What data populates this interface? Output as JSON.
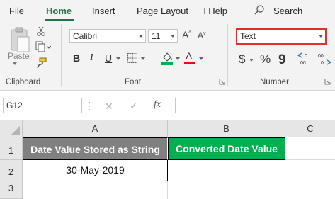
{
  "menu": {
    "tabs": [
      "File",
      "Home",
      "Insert",
      "Page Layout",
      "Help"
    ],
    "search_label": "Search"
  },
  "ribbon": {
    "clipboard": {
      "paste_label": "Paste",
      "group_label": "Clipboard"
    },
    "font": {
      "font_name": "Calibri",
      "font_size": "11",
      "group_label": "Font"
    },
    "number": {
      "format_value": "Text",
      "group_label": "Number"
    }
  },
  "formula_bar": {
    "name_box": "G12",
    "fx_label": "fx",
    "formula": ""
  },
  "grid": {
    "columns": [
      "A",
      "B",
      "C"
    ],
    "rows": [
      "1",
      "2",
      "3"
    ],
    "cells": {
      "A1": "Date Value Stored as String",
      "B1": "Converted Date Value",
      "A2": "30-May-2019",
      "B2": ""
    }
  },
  "colors": {
    "accent": "#217346",
    "header_a1_fill": "#808080",
    "header_b1_fill": "#00b050",
    "highlight_border": "#e02f2f"
  }
}
